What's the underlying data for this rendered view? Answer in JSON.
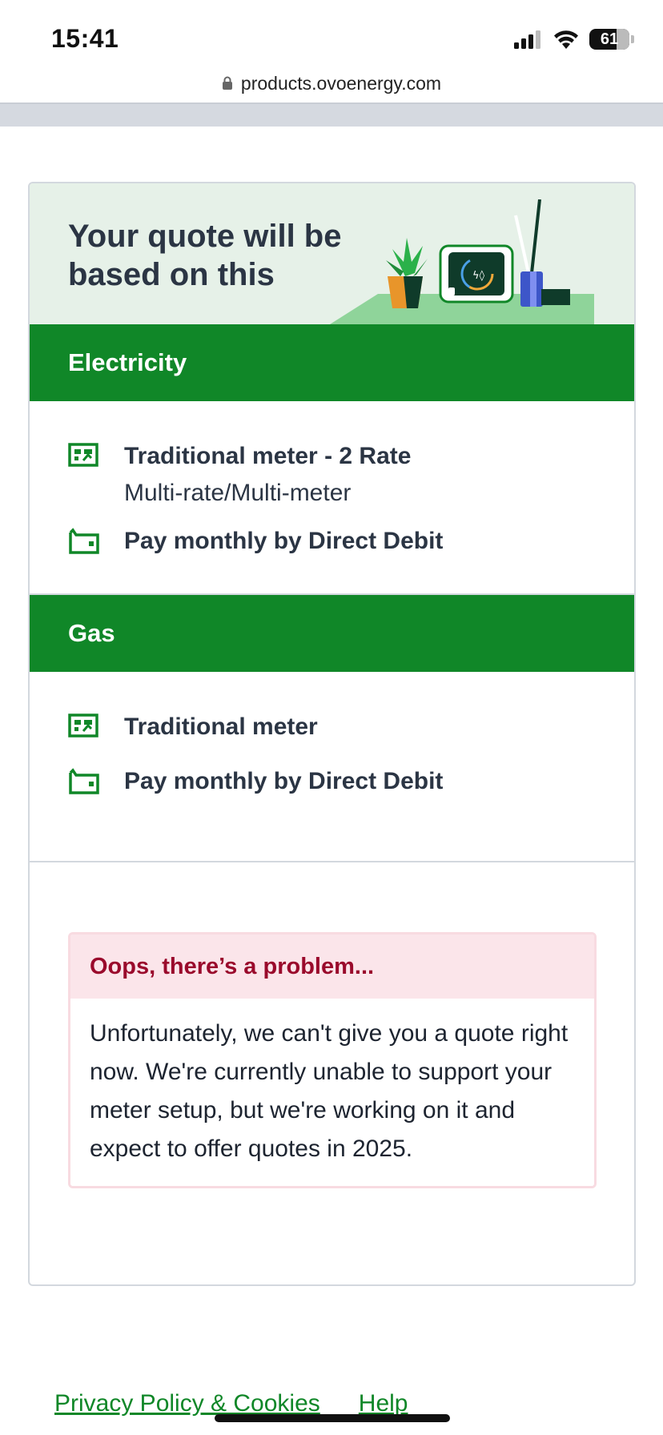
{
  "status_bar": {
    "time": "15:41",
    "battery": "61"
  },
  "browser": {
    "url": "products.ovoenergy.com"
  },
  "quote": {
    "title": "Your quote will be based on this"
  },
  "electricity": {
    "heading": "Electricity",
    "meter_type": "Traditional meter - 2 Rate",
    "meter_subtype": "Multi-rate/Multi-meter",
    "payment": "Pay monthly by Direct Debit"
  },
  "gas": {
    "heading": "Gas",
    "meter_type": "Traditional meter",
    "payment": "Pay monthly by Direct Debit"
  },
  "error": {
    "title": "Oops, there’s a problem...",
    "message": "Unfortunately, we can't give you a quote right now. We're currently unable to support your meter setup, but we're working on it and expect to offer quotes in 2025."
  },
  "footer": {
    "privacy_link": "Privacy Policy & Cookies",
    "help_link": "Help"
  },
  "colors": {
    "brand_green": "#108728",
    "header_bg": "#e6f1e8",
    "error_text": "#9a0a2c",
    "error_bg": "#fbe5ea"
  },
  "icons": {
    "meter": "meter-icon",
    "wallet": "wallet-icon",
    "lock": "lock-icon"
  }
}
